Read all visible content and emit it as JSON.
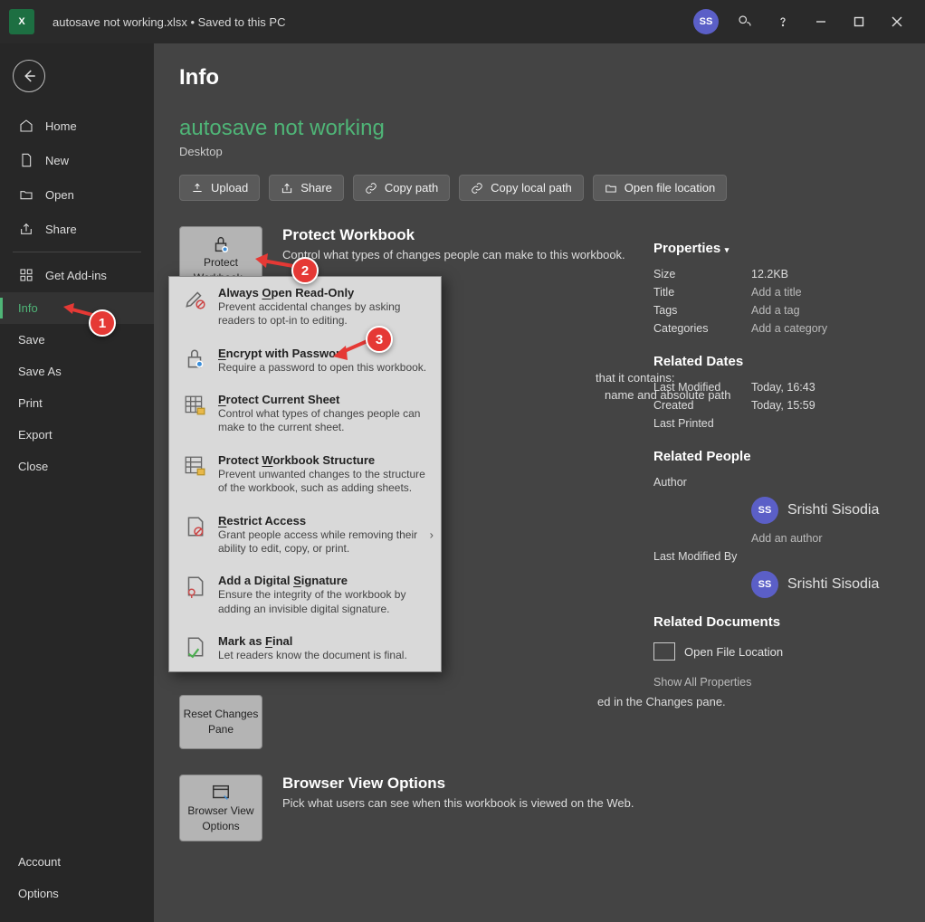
{
  "titlebar": {
    "app_initials": "X",
    "filename": "autosave not working.xlsx",
    "save_state": "Saved to this PC",
    "user_initials": "SS"
  },
  "nav": {
    "home": "Home",
    "new": "New",
    "open": "Open",
    "share": "Share",
    "addins": "Get Add-ins",
    "info": "Info",
    "save": "Save",
    "saveas": "Save As",
    "print": "Print",
    "export": "Export",
    "close": "Close",
    "account": "Account",
    "options": "Options"
  },
  "page": {
    "title": "Info",
    "doc_title": "autosave not working",
    "doc_location": "Desktop"
  },
  "actions": {
    "upload": "Upload",
    "share": "Share",
    "copypath": "Copy path",
    "copylocal": "Copy local path",
    "openloc": "Open file location"
  },
  "sections": {
    "protect": {
      "btn1": "Protect",
      "btn2": "Workbook",
      "title": "Protect Workbook",
      "desc": "Control what types of changes people can make to this workbook."
    },
    "inspect": {
      "hint1": "that it contains:",
      "hint2": "name and absolute path"
    },
    "changes": {
      "btn1": "Reset Changes",
      "btn2": "Pane",
      "hint": "ed in the Changes pane."
    },
    "browser": {
      "btn1": "Browser View",
      "btn2": "Options",
      "title": "Browser View Options",
      "desc": "Pick what users can see when this workbook is viewed on the Web."
    }
  },
  "dropdown": [
    {
      "title_pre": "Always ",
      "title_u": "O",
      "title_post": "pen Read-Only",
      "desc": "Prevent accidental changes by asking readers to opt-in to editing."
    },
    {
      "title_pre": "",
      "title_u": "E",
      "title_post": "ncrypt with Password",
      "desc": "Require a password to open this workbook."
    },
    {
      "title_pre": "",
      "title_u": "P",
      "title_post": "rotect Current Sheet",
      "desc": "Control what types of changes people can make to the current sheet."
    },
    {
      "title_pre": "Protect ",
      "title_u": "W",
      "title_post": "orkbook Structure",
      "desc": "Prevent unwanted changes to the structure of the workbook, such as adding sheets."
    },
    {
      "title_pre": "",
      "title_u": "R",
      "title_post": "estrict Access",
      "desc": "Grant people access while removing their ability to edit, copy, or print.",
      "arrow": true
    },
    {
      "title_pre": "Add a Digital ",
      "title_u": "S",
      "title_post": "ignature",
      "desc": "Ensure the integrity of the workbook by adding an invisible digital signature."
    },
    {
      "title_pre": "Mark as ",
      "title_u": "F",
      "title_post": "inal",
      "desc": "Let readers know the document is final."
    }
  ],
  "props": {
    "heading": "Properties",
    "size_l": "Size",
    "size_v": "12.2KB",
    "title_l": "Title",
    "title_v": "Add a title",
    "tags_l": "Tags",
    "tags_v": "Add a tag",
    "cat_l": "Categories",
    "cat_v": "Add a category",
    "dates_h": "Related Dates",
    "mod_l": "Last Modified",
    "mod_v": "Today, 16:43",
    "created_l": "Created",
    "created_v": "Today, 15:59",
    "printed_l": "Last Printed",
    "people_h": "Related People",
    "author_l": "Author",
    "author_name": "Srishti Sisodia",
    "author_initials": "SS",
    "add_author": "Add an author",
    "modby_l": "Last Modified By",
    "modby_name": "Srishti Sisodia",
    "docs_h": "Related Documents",
    "open_loc": "Open File Location",
    "show_all": "Show All Properties"
  },
  "markers": {
    "m1": "1",
    "m2": "2",
    "m3": "3"
  }
}
